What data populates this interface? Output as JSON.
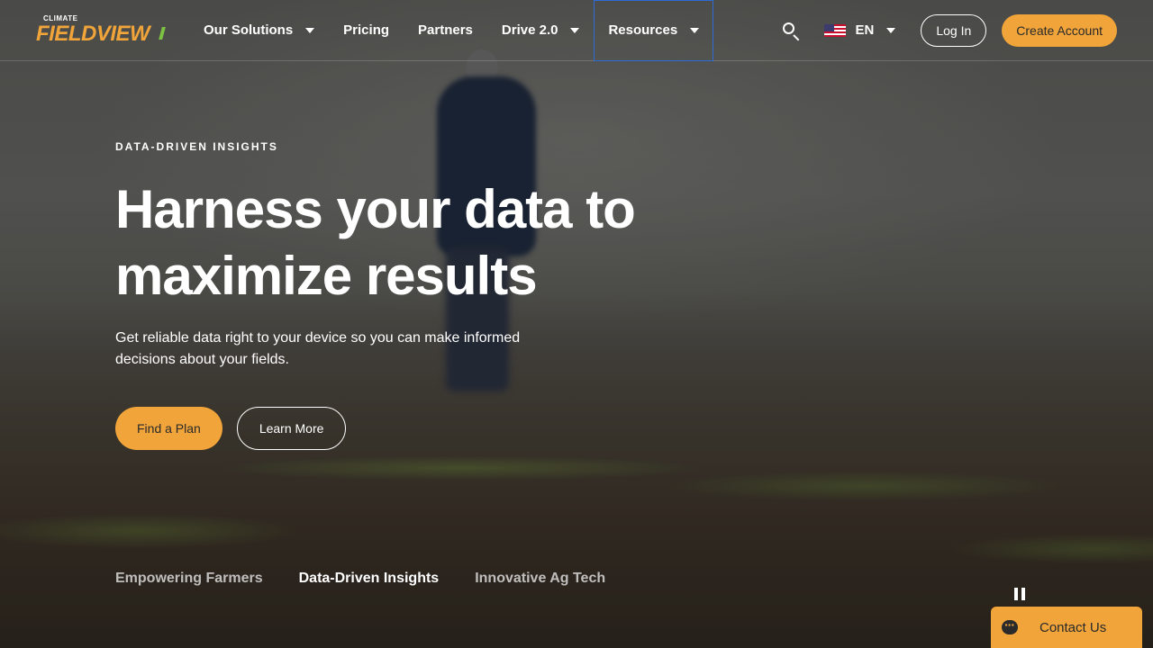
{
  "brand": {
    "small_text": "CLIMATE",
    "name": "FIELDVIEW",
    "colors": {
      "accent": "#f0a43a",
      "green": "#7cc142",
      "focus": "#2e6bd6"
    }
  },
  "nav": {
    "items": [
      {
        "label": "Our Solutions",
        "dropdown": true
      },
      {
        "label": "Pricing",
        "dropdown": false
      },
      {
        "label": "Partners",
        "dropdown": false
      },
      {
        "label": "Drive 2.0",
        "dropdown": true
      },
      {
        "label": "Resources",
        "dropdown": true,
        "focused": true
      }
    ],
    "search_icon": "search-icon",
    "language": {
      "code": "EN",
      "flag": "us-flag-icon"
    },
    "login_label": "Log In",
    "create_account_label": "Create Account"
  },
  "hero": {
    "eyebrow": "DATA-DRIVEN INSIGHTS",
    "headline": "Harness your data to maximize results",
    "subtext": "Get reliable data right to your device so you can make informed decisions about your fields.",
    "primary_cta": "Find a Plan",
    "secondary_cta": "Learn More"
  },
  "slides": {
    "tabs": [
      {
        "label": "Empowering Farmers",
        "active": false
      },
      {
        "label": "Data-Driven Insights",
        "active": true
      },
      {
        "label": "Innovative Ag Tech",
        "active": false
      }
    ],
    "pause_icon": "pause-icon"
  },
  "contact": {
    "label": "Contact Us",
    "icon": "chat-icon"
  }
}
